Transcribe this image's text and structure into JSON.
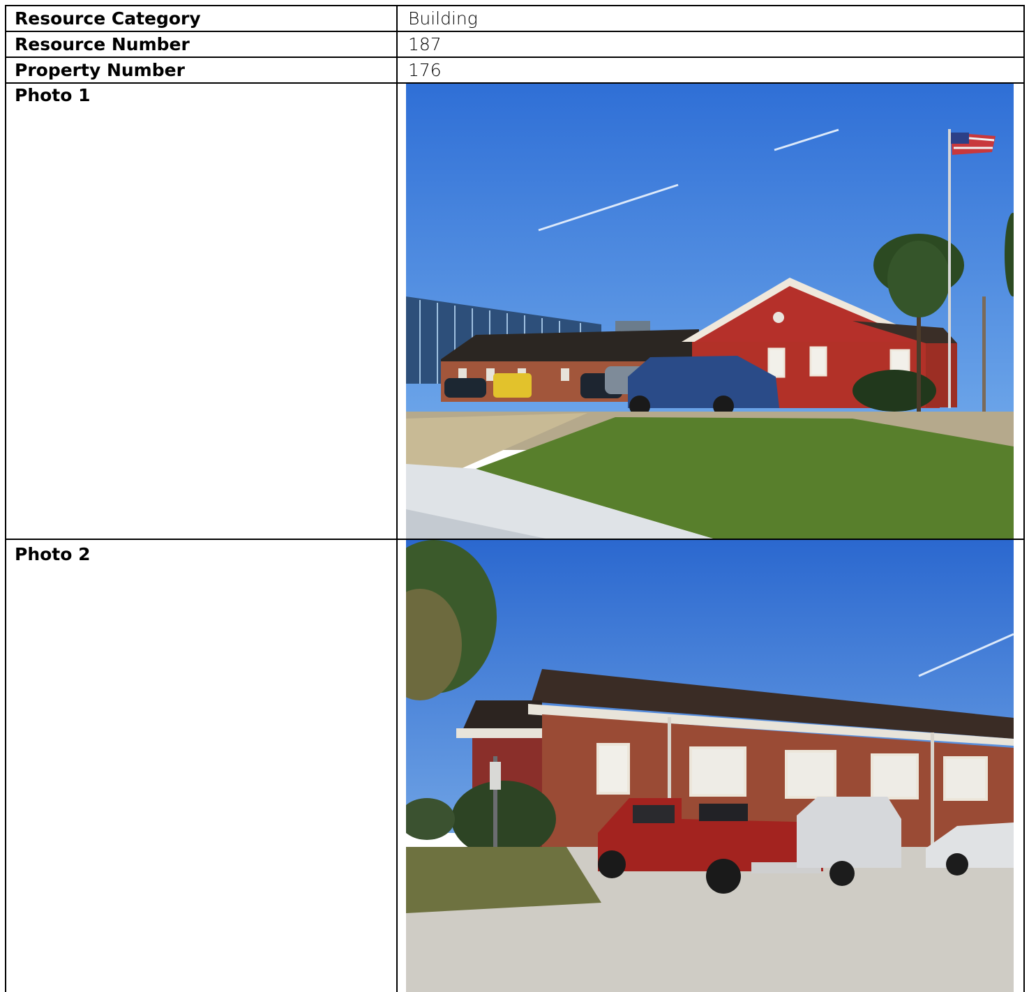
{
  "rows": [
    {
      "label": "Resource Category",
      "value": "Building"
    },
    {
      "label": "Resource Number",
      "value": "187"
    },
    {
      "label": "Property Number",
      "value": "176"
    }
  ],
  "photos": [
    {
      "label": "Photo 1",
      "subject": "photo-building-front"
    },
    {
      "label": "Photo 2",
      "subject": "photo-building-side"
    }
  ],
  "colors": {
    "border": "#000000",
    "sky": "#3d7fd9",
    "brick": "#a52e25",
    "grass": "#4f7f27"
  }
}
